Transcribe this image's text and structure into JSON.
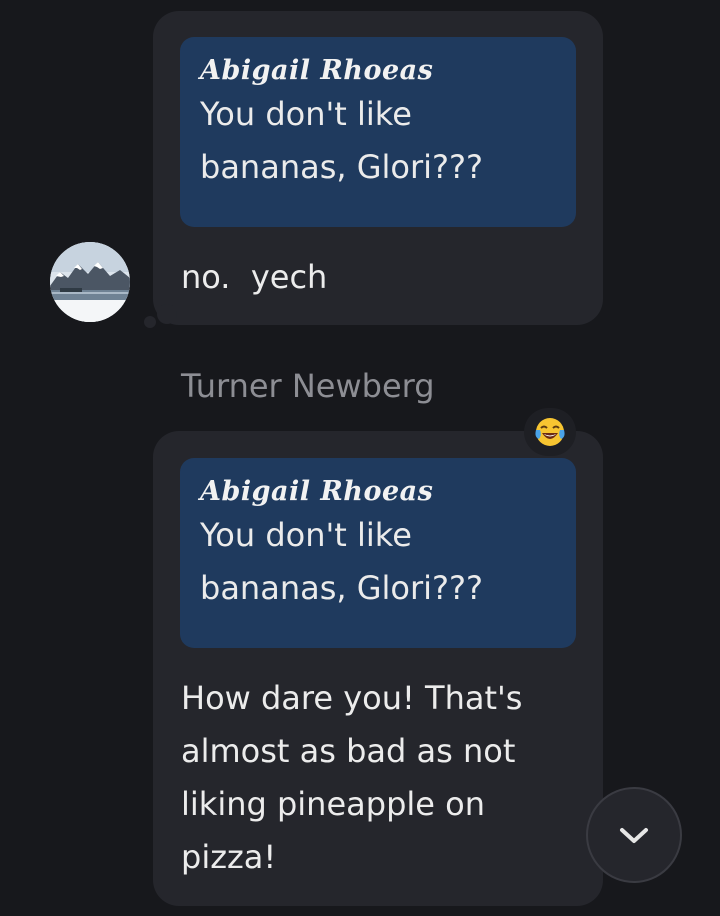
{
  "messages": [
    {
      "quote": {
        "author": "Abigail Rhoeas",
        "text_lines": [
          "You don't like",
          "bananas, Glori???"
        ]
      },
      "text_lines": [
        "no.  yech"
      ]
    },
    {
      "sender": "Turner Newberg",
      "reaction": "face-with-tears-of-joy",
      "quote": {
        "author": "Abigail Rhoeas",
        "text_lines": [
          "You don't like",
          "bananas, Glori???"
        ]
      },
      "text_lines": [
        "How dare you! That's",
        "almost as bad as not",
        "liking pineapple on",
        "pizza!"
      ]
    }
  ],
  "colors": {
    "background": "#17181c",
    "bubble": "#25262c",
    "quote": "#1f3a5e"
  },
  "icons": {
    "scroll_down": "chevron-down-icon",
    "avatar": "mountain-lake-avatar"
  }
}
